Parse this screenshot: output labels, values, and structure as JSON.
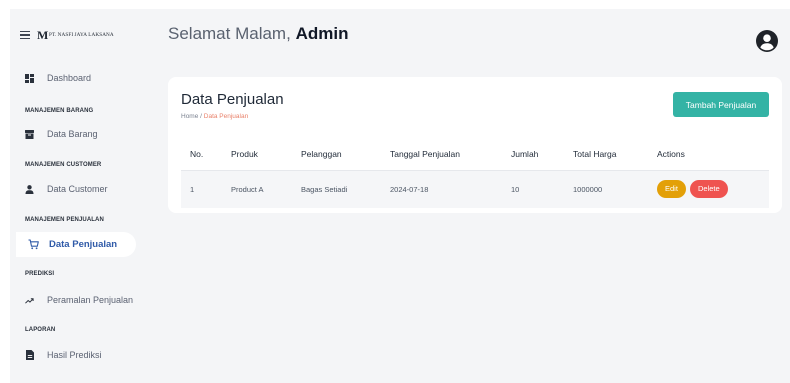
{
  "brand": {
    "logo_letter": "M",
    "name": "PT. NASFI JAYA LAKSANA"
  },
  "sidebar": {
    "items": [
      {
        "label": "Dashboard",
        "icon": "dashboard-icon"
      },
      {
        "section": "MANAJEMEN BARANG"
      },
      {
        "label": "Data Barang",
        "icon": "box-icon"
      },
      {
        "section": "MANAJEMEN CUSTOMER"
      },
      {
        "label": "Data Customer",
        "icon": "user-icon"
      },
      {
        "section": "MANAJEMEN PENJUALAN"
      },
      {
        "label": "Data Penjualan",
        "icon": "cart-icon",
        "active": true
      },
      {
        "section": "PREDIKSI"
      },
      {
        "label": "Peramalan Penjualan",
        "icon": "trend-icon"
      },
      {
        "section": "LAPORAN"
      },
      {
        "label": "Hasil Prediksi",
        "icon": "document-icon"
      }
    ]
  },
  "header": {
    "greeting": "Selamat Malam,",
    "user": "Admin"
  },
  "page": {
    "title": "Data Penjualan",
    "breadcrumb": {
      "home": "Home",
      "sep": " / ",
      "current": "Data Penjualan"
    },
    "add_button": "Tambah Penjualan"
  },
  "table": {
    "columns": [
      "No.",
      "Produk",
      "Pelanggan",
      "Tanggal Penjualan",
      "Jumlah",
      "Total Harga",
      "Actions"
    ],
    "rows": [
      {
        "no": "1",
        "produk": "Product A",
        "pelanggan": "Bagas Setiadi",
        "tanggal": "2024-07-18",
        "jumlah": "10",
        "total": "1000000",
        "edit": "Edit",
        "delete": "Delete"
      }
    ]
  },
  "colors": {
    "accent": "#34b3a5",
    "edit": "#e3a008",
    "delete": "#ef5350",
    "active_text": "#2f5aa8",
    "breadcrumb_current": "#e9826b"
  }
}
